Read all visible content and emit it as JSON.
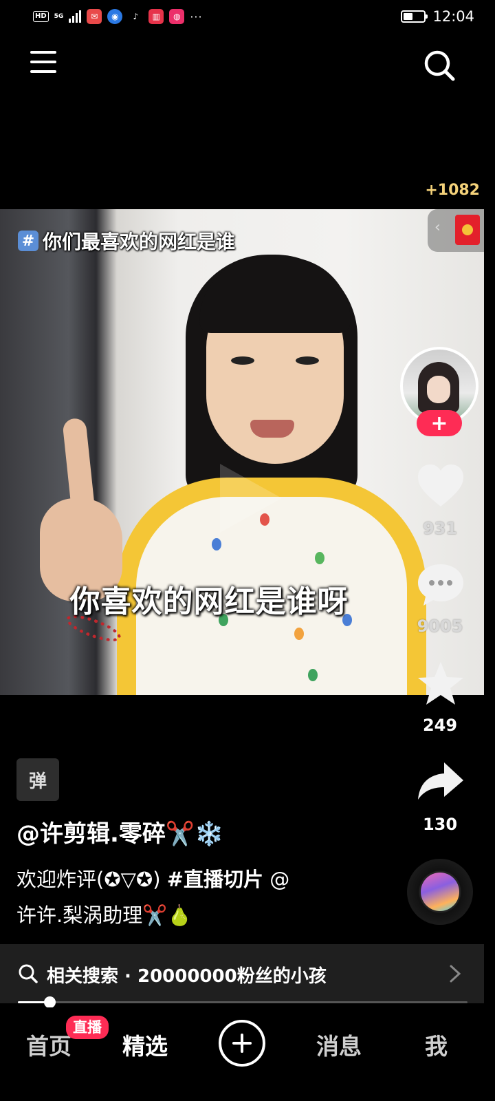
{
  "status_bar": {
    "network_hd": "HD",
    "network_5g": "5G",
    "more": "···",
    "battery_level": 0.45,
    "time": "12:04",
    "notification_icons": [
      "mail-app-icon",
      "browser-app-icon",
      "tiktok-app-icon",
      "reader-app-icon",
      "shopping-app-icon"
    ]
  },
  "top_nav": {
    "menu_icon": "menu-icon",
    "search_icon": "search-icon"
  },
  "reward": {
    "text": "+1082"
  },
  "video": {
    "hashtag_overlay": "你们最喜欢的网红是谁",
    "hash_symbol": "#",
    "caption_overlay": "你喜欢的网红是谁呀"
  },
  "actions": {
    "likes": "931",
    "comments": "9005",
    "favorites": "249",
    "shares": "130",
    "follow_label": "+"
  },
  "post": {
    "badge": "弹",
    "author": "@许剪辑.零碎✂️❄️",
    "description_line1_prefix": "欢迎炸评(✪▽✪) ",
    "description_hashtag": "#直播切片",
    "description_line1_suffix": " @",
    "description_line2": "许许.梨涡助理✂️🍐"
  },
  "related_search": {
    "text": "相关搜索 · 20000000粉丝的小孩"
  },
  "playback": {
    "progress": 0.07
  },
  "tabbar": {
    "home": "首页",
    "live_badge": "直播",
    "featured": "精选",
    "create": "+",
    "messages": "消息",
    "me": "我"
  },
  "colors": {
    "accent": "#fe2c55",
    "reward": "#f4d27a",
    "background": "#000000"
  }
}
